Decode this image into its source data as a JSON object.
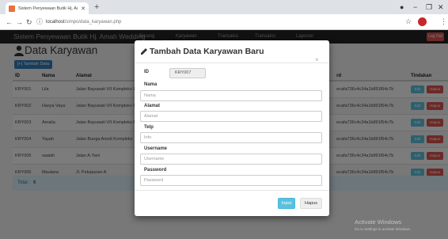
{
  "browser": {
    "tab_title": "Sistem Penyewaan Butik Hj. Amal",
    "url_host": "localhost",
    "url_path": "/simpo/data_karyawan.php"
  },
  "navbar": {
    "brand": "Sistem Penyewaan Butik Hj. Amah Wedding",
    "links": [
      "Barang",
      "Karyawan",
      "Transaksi",
      "Transaksi",
      "Laporan"
    ],
    "logout_label": "Log Out"
  },
  "page": {
    "title": "Data Karyawan",
    "add_button": "[+] Tambah Data",
    "columns": [
      "ID",
      "Nama",
      "Alamat",
      "rd",
      "Tindakan"
    ],
    "rows": [
      {
        "id": "KRY001",
        "nama": "Lila",
        "alamat": "Jalan Bayuwati VII Kompleks PU",
        "pass": "ecafa736c4c34a1b891f54c7b"
      },
      {
        "id": "KRY002",
        "nama": "Hasya Vaya",
        "alamat": "Jalan Bayuwati VII Kompleks PU",
        "pass": "ecafa736c4c34a1b891f54c7b"
      },
      {
        "id": "KRY003",
        "nama": "Amalia",
        "alamat": "Jalan Bayuwati VII Kompleks PU",
        "pass": "ecafa736c4c34a1b891f54c7b"
      },
      {
        "id": "KRY004",
        "nama": "Yayah",
        "alamat": "Jalan Bunga Anedi Kompleks",
        "pass": "ecafa736c4c34a1b891f54c7b"
      },
      {
        "id": "KRY005",
        "nama": "saalah",
        "alamat": "Jalan A.Yani",
        "pass": "ecafa736c4c34a1b891f54c7b"
      },
      {
        "id": "KRY006",
        "nama": "Maulana",
        "alamat": "Jl. Pekapuran A",
        "pass": "ecafa736c4c34a1b891f54c7b"
      }
    ],
    "edit_label": "Edit",
    "delete_label": "Hapus",
    "total_label": "Total :",
    "total_value": "6"
  },
  "modal": {
    "title": "Tambah Data Karyawan Baru",
    "id_label": "ID",
    "id_value": "KRY007",
    "nama_label": "Nama",
    "nama_placeholder": "Nama",
    "alamat_label": "Alamat",
    "alamat_placeholder": "Alamat",
    "telp_label": "Telp",
    "telp_placeholder": "Info",
    "username_label": "Username",
    "username_placeholder": "Username",
    "password_label": "Password",
    "password_placeholder": "Password",
    "submit_label": "Input",
    "cancel_label": "Hapus"
  },
  "watermark": {
    "title": "Activate Windows",
    "subtitle": "Go to Settings to activate Windows."
  },
  "colors": {
    "navbar_bg": "#222222",
    "primary": "#337ab7",
    "info": "#5bc0de",
    "danger": "#d9534f",
    "favicon": "#e8713c"
  }
}
